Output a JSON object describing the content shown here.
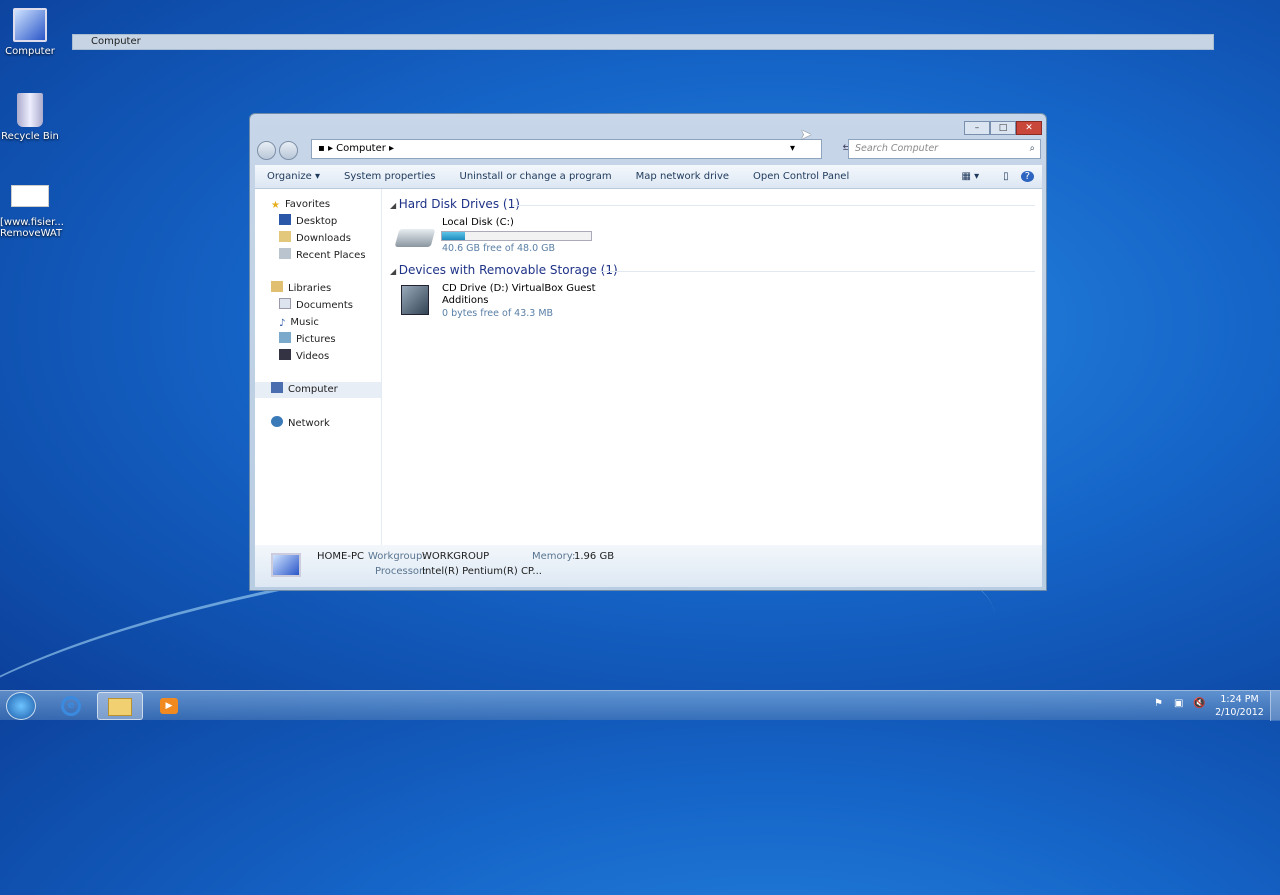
{
  "desktop": {
    "icons": [
      {
        "label": "Computer"
      },
      {
        "label": "Recycle Bin"
      },
      {
        "label": "[www.fisier...",
        "label2": "RemoveWAT"
      }
    ]
  },
  "thumbnail_title": "Computer",
  "window": {
    "controls": {
      "minimize": "–",
      "maximize": "□",
      "close": "✕"
    },
    "address": {
      "path": "Computer"
    },
    "search": {
      "placeholder": "Search Computer"
    },
    "toolbar": [
      "Organize ▾",
      "System properties",
      "Uninstall or change a program",
      "Map network drive",
      "Open Control Panel"
    ],
    "nav": {
      "favorites": "Favorites",
      "fav_items": [
        "Desktop",
        "Downloads",
        "Recent Places"
      ],
      "libraries": "Libraries",
      "lib_items": [
        "Documents",
        "Music",
        "Pictures",
        "Videos"
      ],
      "computer": "Computer",
      "network": "Network"
    },
    "groups": [
      {
        "title": "Hard Disk Drives (1)",
        "items": [
          {
            "name": "Local Disk (C:)",
            "detail": "40.6 GB free of 48.0 GB",
            "used_fraction": 0.154
          }
        ]
      },
      {
        "title": "Devices with Removable Storage (1)",
        "items": [
          {
            "name": "CD Drive (D:) VirtualBox Guest",
            "name2": "Additions",
            "detail": "0 bytes free of 43.3 MB"
          }
        ]
      }
    ],
    "details": {
      "name": "HOME-PC",
      "workgroup_label": "Workgroup:",
      "workgroup": "WORKGROUP",
      "memory_label": "Memory:",
      "memory": "1.96 GB",
      "processor_label": "Processor:",
      "processor": "Intel(R) Pentium(R) CP..."
    }
  },
  "taskbar": {
    "time": "1:24 PM",
    "date": "2/10/2012"
  },
  "colors": {
    "accent": "#1e3287",
    "bar": "#26a0da"
  }
}
